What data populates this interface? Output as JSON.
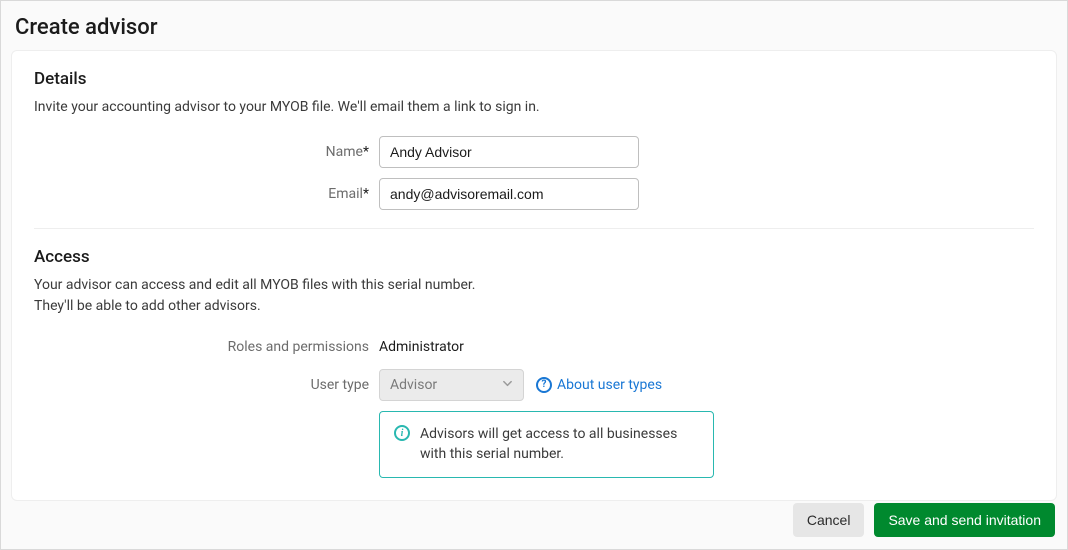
{
  "page": {
    "title": "Create advisor"
  },
  "details": {
    "heading": "Details",
    "description": "Invite your accounting advisor to your MYOB file. We'll email them a link to sign in.",
    "name_label": "Name",
    "name_value": "Andy Advisor",
    "email_label": "Email",
    "email_value": "andy@advisoremail.com",
    "required_mark": "*"
  },
  "access": {
    "heading": "Access",
    "description_line1": "Your advisor can access and edit all MYOB files with this serial number.",
    "description_line2": "They'll be able to add other advisors.",
    "roles_label": "Roles and permissions",
    "roles_value": "Administrator",
    "user_type_label": "User type",
    "user_type_value": "Advisor",
    "about_link": "About user types",
    "info_text": "Advisors will get access to all businesses with this serial number."
  },
  "footer": {
    "cancel": "Cancel",
    "save": "Save and send invitation"
  }
}
